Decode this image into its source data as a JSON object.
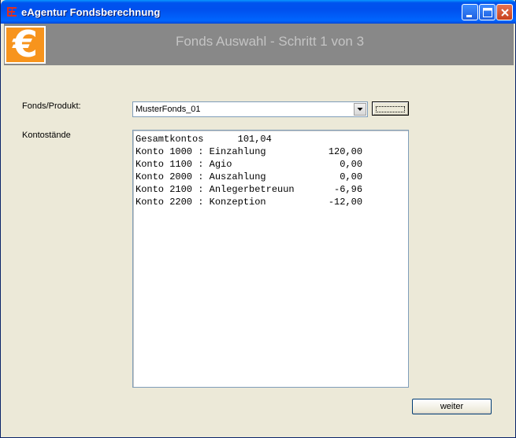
{
  "window": {
    "title": "eAgentur Fondsberechnung"
  },
  "banner": {
    "logo_symbol": "€",
    "title": "Fonds Auswahl - Schritt 1 von 3",
    "background": "#888888",
    "logo_color": "#f7941d"
  },
  "form": {
    "fonds_label": "Fonds/Produkt:",
    "fonds_value": "MusterFonds_01",
    "browse_label": "",
    "kontostaende_label": "Kontostände",
    "kontostaende_lines": [
      "Gesamtkontos      101,04",
      "Konto 1000 : Einzahlung           120,00",
      "Konto 1100 : Agio                   0,00",
      "Konto 2000 : Auszahlung             0,00",
      "Konto 2100 : Anlegerbetreuun       -6,96",
      "Konto 2200 : Konzeption           -12,00"
    ]
  },
  "footer": {
    "next_label": "weiter"
  },
  "icons": {
    "app": "app-icon",
    "minimize": "minimize-icon",
    "maximize": "maximize-icon",
    "close": "close-icon",
    "dropdown": "chevron-down-icon"
  }
}
